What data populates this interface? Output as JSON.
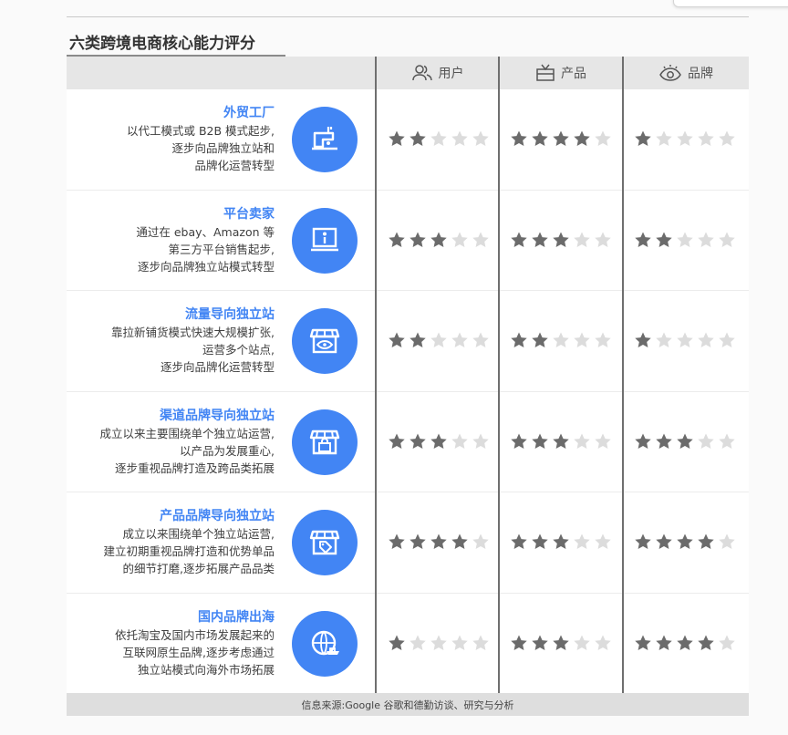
{
  "title": "六类跨境电商核心能力评分",
  "columns": [
    {
      "label": "用户",
      "icon": "users-icon"
    },
    {
      "label": "产品",
      "icon": "product-box-icon"
    },
    {
      "label": "品牌",
      "icon": "eye-icon"
    }
  ],
  "rows": [
    {
      "name": "外贸工厂",
      "lines": [
        "以代工模式或 B2B 模式起步,",
        "逐步向品牌独立站和",
        "品牌化运营转型"
      ],
      "icon": "sewing-machine-icon",
      "ratings": [
        2,
        4,
        1
      ]
    },
    {
      "name": "平台卖家",
      "lines": [
        "通过在 ebay、Amazon 等",
        "第三方平台销售起步,",
        "逐步向品牌独立站模式转型"
      ],
      "icon": "laptop-user-icon",
      "ratings": [
        3,
        3,
        2
      ]
    },
    {
      "name": "流量导向独立站",
      "lines": [
        "靠拉新铺货模式快速大规模扩张,",
        "运营多个站点,",
        "逐步向品牌化运营转型"
      ],
      "icon": "storefront-eye-icon",
      "ratings": [
        2,
        2,
        1
      ]
    },
    {
      "name": "渠道品牌导向独立站",
      "lines": [
        "成立以来主要围绕单个独立站运营,",
        "以产品为发展重心,",
        "逐步重视品牌打造及跨品类拓展"
      ],
      "icon": "storefront-bag-icon",
      "ratings": [
        3,
        3,
        3
      ]
    },
    {
      "name": "产品品牌导向独立站",
      "lines": [
        "成立以来围绕单个独立站运营,",
        "建立初期重视品牌打造和优势单品",
        "的细节打磨,逐步拓展产品品类"
      ],
      "icon": "storefront-tag-icon",
      "ratings": [
        4,
        3,
        4
      ]
    },
    {
      "name": "国内品牌出海",
      "lines": [
        "依托淘宝及国内市场发展起来的",
        "互联网原生品牌,逐步考虑通过",
        "独立站模式向海外市场拓展"
      ],
      "icon": "globe-ship-icon",
      "ratings": [
        1,
        3,
        4
      ]
    }
  ],
  "max_rating": 5,
  "footer": "信息来源:Google 谷歌和德勤访谈、研究与分析",
  "colors": {
    "accent": "#4285f4",
    "star_on": "#6b6b6b",
    "star_off": "#dcdcdc"
  }
}
